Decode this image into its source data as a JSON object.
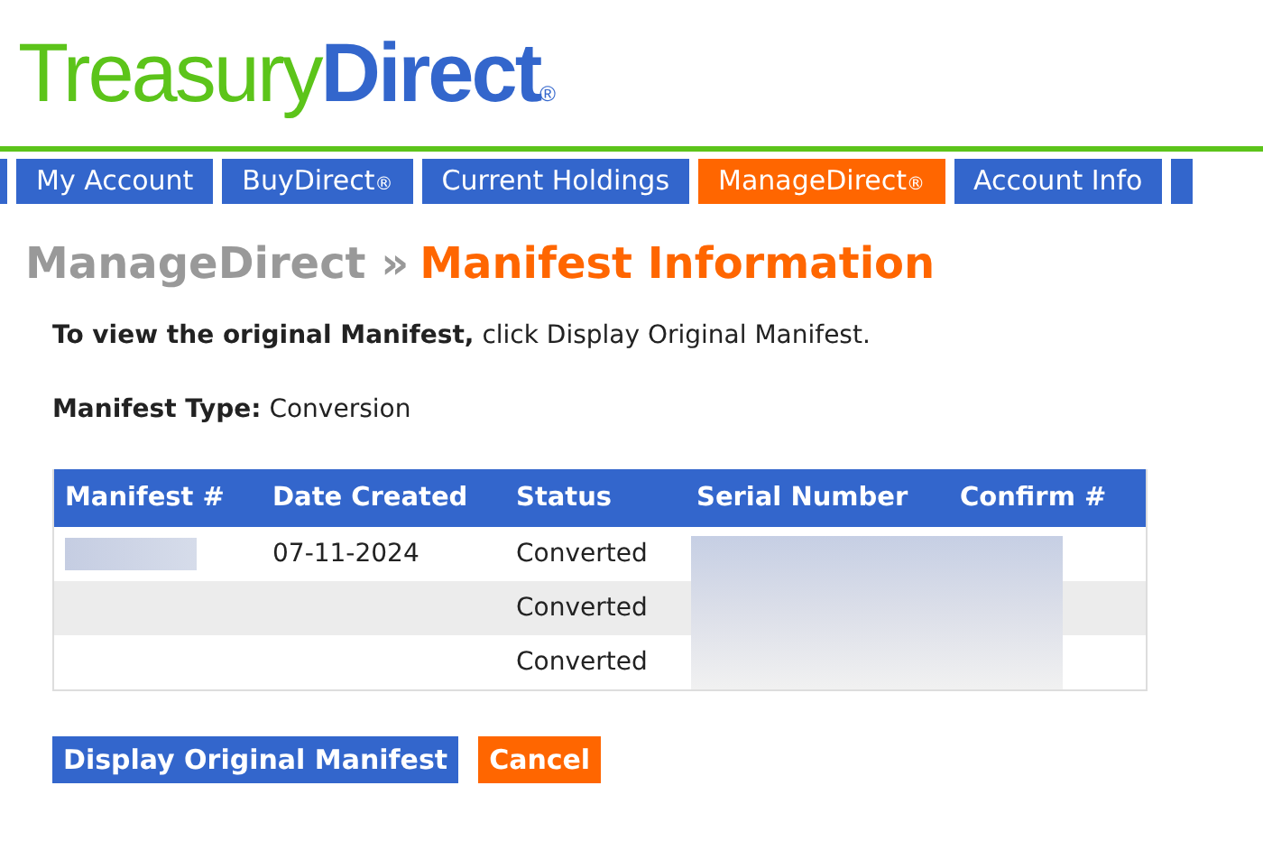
{
  "logo": {
    "part_1": "Treasury",
    "part_2": "Direct",
    "mark": "®"
  },
  "tabs": [
    {
      "label": "My Account",
      "selected": false
    },
    {
      "label": "BuyDirect",
      "mark": "®",
      "selected": false
    },
    {
      "label": "Current Holdings",
      "selected": false
    },
    {
      "label": "ManageDirect",
      "mark": "®",
      "selected": true
    },
    {
      "label": "Account Info",
      "selected": false
    }
  ],
  "heading": {
    "section": "ManageDirect",
    "separator": "»",
    "title": "Manifest Information"
  },
  "intro": "**To view the original Manifest,** click Display Original Manifest.",
  "manifest_type": {
    "label": "Manifest Type:",
    "value": "Conversion"
  },
  "table": {
    "columns": [
      "Manifest #",
      "Date Created",
      "Status",
      "Serial Number",
      "Confirm #"
    ],
    "rows": [
      {
        "manifest_redacted": true,
        "date": "07-11-2024",
        "status": "Converted"
      },
      {
        "manifest_redacted": false,
        "status": "Converted"
      },
      {
        "manifest_redacted": false,
        "status": "Converted"
      }
    ],
    "serial_redacted": true
  },
  "buttons": [
    {
      "label": "Display Original Manifest",
      "kind": "primary"
    },
    {
      "label": "Cancel",
      "kind": "cancel"
    }
  ]
}
